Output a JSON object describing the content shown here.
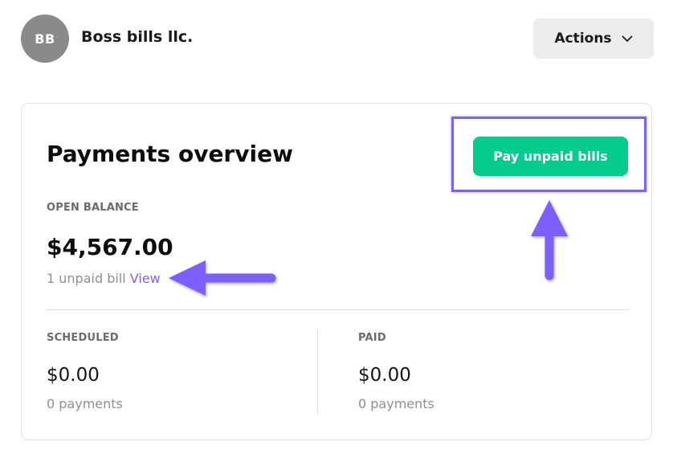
{
  "header": {
    "avatar_initials": "BB",
    "company_name": "Boss bills llc.",
    "actions_label": "Actions"
  },
  "overview": {
    "title": "Payments overview",
    "pay_button_label": "Pay unpaid bills",
    "open_balance": {
      "label": "OPEN BALANCE",
      "amount": "$4,567.00",
      "unpaid_text": "1 unpaid bill",
      "view_link": "View"
    },
    "scheduled": {
      "label": "SCHEDULED",
      "amount": "$0.00",
      "count_text": "0 payments"
    },
    "paid": {
      "label": "PAID",
      "amount": "$0.00",
      "count_text": "0 payments"
    }
  },
  "annotations": {
    "accent_color": "#7b61ff",
    "pay_button_color": "#03cc8c"
  }
}
